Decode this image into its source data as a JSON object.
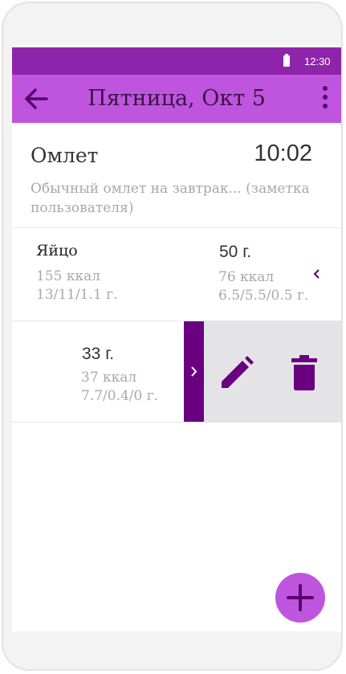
{
  "status_bar": {
    "time": "12:30"
  },
  "app_bar": {
    "title": "Пятница, Окт 5"
  },
  "meal": {
    "name": "Омлет",
    "time": "10:02",
    "note": "Обычный омлет на завтрак... (заметка пользователя)"
  },
  "items": [
    {
      "name": "Яйцо",
      "kcal": "155 ккал",
      "macros": "13/11/1.1 г.",
      "weight": "50 г.",
      "weight_kcal": "76 ккал",
      "weight_macros": "6.5/5.5/0.5 г."
    },
    {
      "weight": "33 г.",
      "weight_kcal": "37 ккал",
      "weight_macros": "7.7/0.4/0 г."
    }
  ],
  "colors": {
    "status_bar": "#8e24aa",
    "app_bar": "#bf55df",
    "accent_dark": "#6a0080",
    "fab": "#bf55df"
  },
  "icons": [
    "back-arrow-icon",
    "more-vert-icon",
    "chevron-left-icon",
    "chevron-right-icon",
    "pencil-icon",
    "trash-icon",
    "plus-icon"
  ]
}
